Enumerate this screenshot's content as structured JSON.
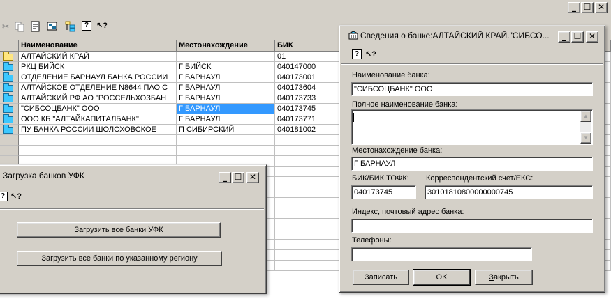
{
  "main": {
    "toolbar_icons": [
      "cut-icon",
      "copy-icon",
      "properties-icon",
      "list-icon",
      "tree-icon",
      "help-icon",
      "whats-this-icon"
    ],
    "help_glyph": "?",
    "whatsthis_glyph": "↖?",
    "grid": {
      "headers": [
        "Наименование",
        "Местонахождение",
        "БИК"
      ],
      "rows": [
        {
          "name": "АЛТАЙСКИЙ КРАЙ",
          "location": "",
          "bik": "01",
          "icon": "open-folder-icon"
        },
        {
          "name": "РКЦ БИЙСК",
          "location": "Г БИЙСК",
          "bik": "040147000",
          "icon": "folder-icon"
        },
        {
          "name": "ОТДЕЛЕНИЕ БАРНАУЛ БАНКА РОССИИ",
          "location": "Г БАРНАУЛ",
          "bik": "040173001",
          "icon": "folder-icon"
        },
        {
          "name": "АЛТАЙСКОЕ ОТДЕЛЕНИЕ N8644 ПАО С",
          "location": "Г БАРНАУЛ",
          "bik": "040173604",
          "icon": "folder-icon"
        },
        {
          "name": "АЛТАЙСКИЙ РФ АО \"РОССЕЛЬХОЗБАН",
          "location": "Г БАРНАУЛ",
          "bik": "040173733",
          "icon": "folder-icon"
        },
        {
          "name": "\"СИБСОЦБАНК\" ООО",
          "location": "Г БАРНАУЛ",
          "bik": "040173745",
          "icon": "folder-icon",
          "selected": true
        },
        {
          "name": "ООО КБ \"АЛТАЙКАПИТАЛБАНК\"",
          "location": "Г БАРНАУЛ",
          "bik": "040173771",
          "icon": "folder-icon"
        },
        {
          "name": "ПУ БАНКА РОССИИ ШОЛОХОВСКОЕ",
          "location": "П СИБИРСКИЙ",
          "bik": "040181002",
          "icon": "folder-icon"
        }
      ]
    }
  },
  "ufk_window": {
    "title": "Загрузка банков УФК",
    "load_all_button": "Загрузить все банки УФК",
    "load_region_button": "Загрузить все банки по указанному региону"
  },
  "bank_window": {
    "title": "Сведения о банке:АЛТАЙСКИЙ КРАЙ.\"СИБСО...",
    "labels": {
      "bank_name": "Наименование банка:",
      "full_name": "Полное наименование банка:",
      "location": "Местонахождение банка:",
      "bik": "БИК/БИК ТОФК:",
      "corr_account": "Корреспондентский счет/ЕКС:",
      "address": "Индекс, почтовый адрес банка:",
      "phones": "Телефоны:"
    },
    "values": {
      "bank_name": "\"СИБСОЦБАНК\" ООО",
      "full_name": "",
      "location": "Г БАРНАУЛ",
      "bik": "040173745",
      "corr_account": "30101810800000000745",
      "address": "",
      "phones": ""
    },
    "buttons": {
      "save": "Записать",
      "ok": "OK",
      "close_first": "З",
      "close_rest": "акрыть"
    }
  },
  "caption_buttons": {
    "minimize": "_",
    "maximize": "☐",
    "close": "✕"
  }
}
